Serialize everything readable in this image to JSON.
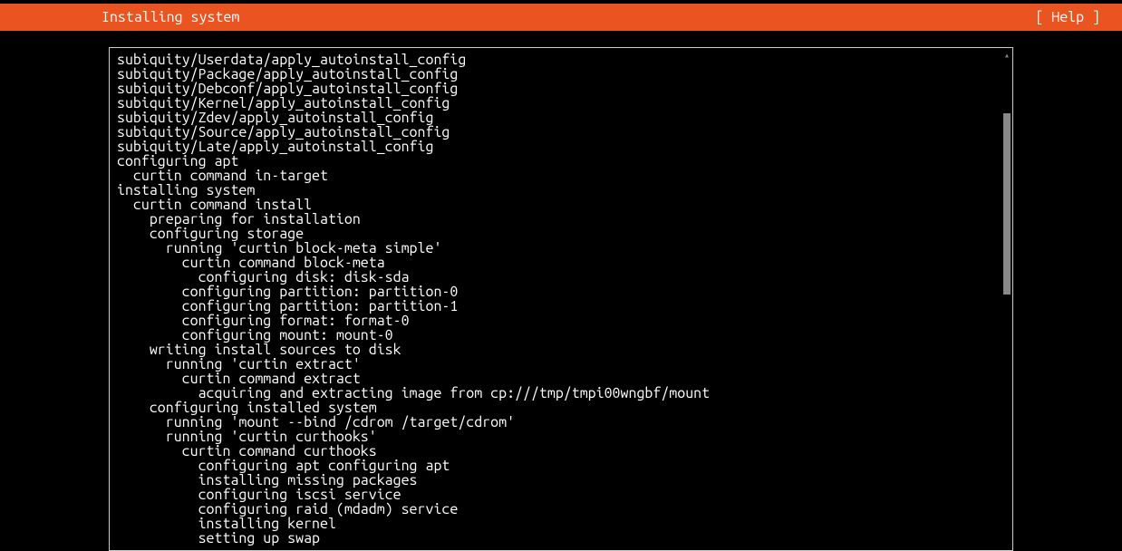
{
  "header": {
    "title": "Installing system",
    "help_label": "[ Help ]"
  },
  "log": {
    "lines": [
      {
        "indent": 0,
        "text": "subiquity/Userdata/apply_autoinstall_config"
      },
      {
        "indent": 0,
        "text": "subiquity/Package/apply_autoinstall_config"
      },
      {
        "indent": 0,
        "text": "subiquity/Debconf/apply_autoinstall_config"
      },
      {
        "indent": 0,
        "text": "subiquity/Kernel/apply_autoinstall_config"
      },
      {
        "indent": 0,
        "text": "subiquity/Zdev/apply_autoinstall_config"
      },
      {
        "indent": 0,
        "text": "subiquity/Source/apply_autoinstall_config"
      },
      {
        "indent": 0,
        "text": "subiquity/Late/apply_autoinstall_config"
      },
      {
        "indent": 0,
        "text": "configuring apt"
      },
      {
        "indent": 2,
        "text": "curtin command in-target"
      },
      {
        "indent": 0,
        "text": "installing system"
      },
      {
        "indent": 2,
        "text": "curtin command install"
      },
      {
        "indent": 4,
        "text": "preparing for installation"
      },
      {
        "indent": 4,
        "text": "configuring storage"
      },
      {
        "indent": 6,
        "text": "running 'curtin block-meta simple'"
      },
      {
        "indent": 8,
        "text": "curtin command block-meta"
      },
      {
        "indent": 10,
        "text": "configuring disk: disk-sda"
      },
      {
        "indent": 8,
        "text": "configuring partition: partition-0"
      },
      {
        "indent": 8,
        "text": "configuring partition: partition-1"
      },
      {
        "indent": 8,
        "text": "configuring format: format-0"
      },
      {
        "indent": 8,
        "text": "configuring mount: mount-0"
      },
      {
        "indent": 4,
        "text": "writing install sources to disk"
      },
      {
        "indent": 6,
        "text": "running 'curtin extract'"
      },
      {
        "indent": 8,
        "text": "curtin command extract"
      },
      {
        "indent": 10,
        "text": "acquiring and extracting image from cp:///tmp/tmpi00wngbf/mount"
      },
      {
        "indent": 4,
        "text": "configuring installed system"
      },
      {
        "indent": 6,
        "text": "running 'mount --bind /cdrom /target/cdrom'"
      },
      {
        "indent": 6,
        "text": "running 'curtin curthooks'"
      },
      {
        "indent": 8,
        "text": "curtin command curthooks"
      },
      {
        "indent": 10,
        "text": "configuring apt configuring apt"
      },
      {
        "indent": 10,
        "text": "installing missing packages"
      },
      {
        "indent": 10,
        "text": "configuring iscsi service"
      },
      {
        "indent": 10,
        "text": "configuring raid (mdadm) service"
      },
      {
        "indent": 10,
        "text": "installing kernel"
      },
      {
        "indent": 10,
        "text": "setting up swap"
      }
    ]
  },
  "scroll": {
    "arrow_up": "▴"
  }
}
